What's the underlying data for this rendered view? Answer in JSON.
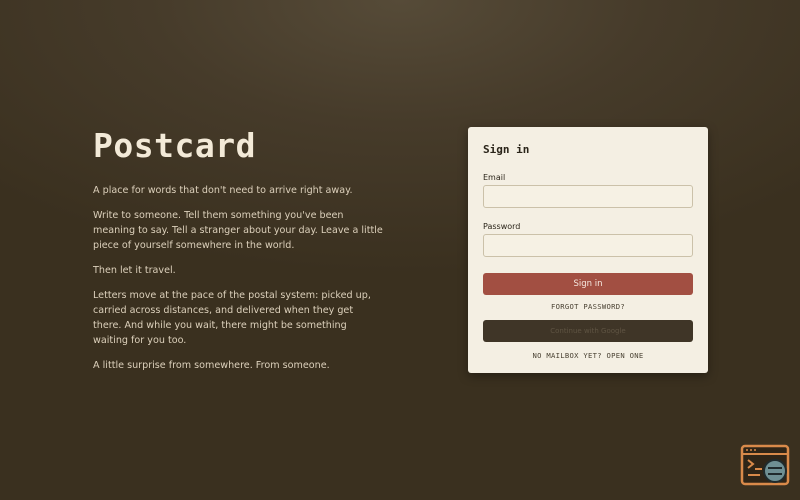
{
  "brand": {
    "title": "Postcard"
  },
  "intro": {
    "paragraphs": [
      "A place for words that don't need to arrive right away.",
      "Write to someone. Tell them something you've been meaning to say. Tell a stranger about your day. Leave a little piece of yourself somewhere in the world.",
      "Then let it travel.",
      "Letters move at the pace of the postal system: picked up, carried across distances, and delivered when they get there. And while you wait, there might be something waiting for you too.",
      "A little surprise from somewhere. From someone."
    ]
  },
  "signin": {
    "title": "Sign in",
    "email_label": "Email",
    "email_value": "",
    "password_label": "Password",
    "password_value": "",
    "submit_label": "Sign in",
    "forgot_label": "FORGOT PASSWORD?",
    "google_label": "Continue with Google",
    "signup_label": "NO MAILBOX YET? OPEN ONE"
  },
  "corner_widget": {
    "icon": "terminal-icon"
  },
  "colors": {
    "background": "#463b2a",
    "card": "#f4efe3",
    "primary_button": "#a24f42",
    "secondary_button": "#3f3527",
    "accent_orange": "#d98a4a"
  }
}
